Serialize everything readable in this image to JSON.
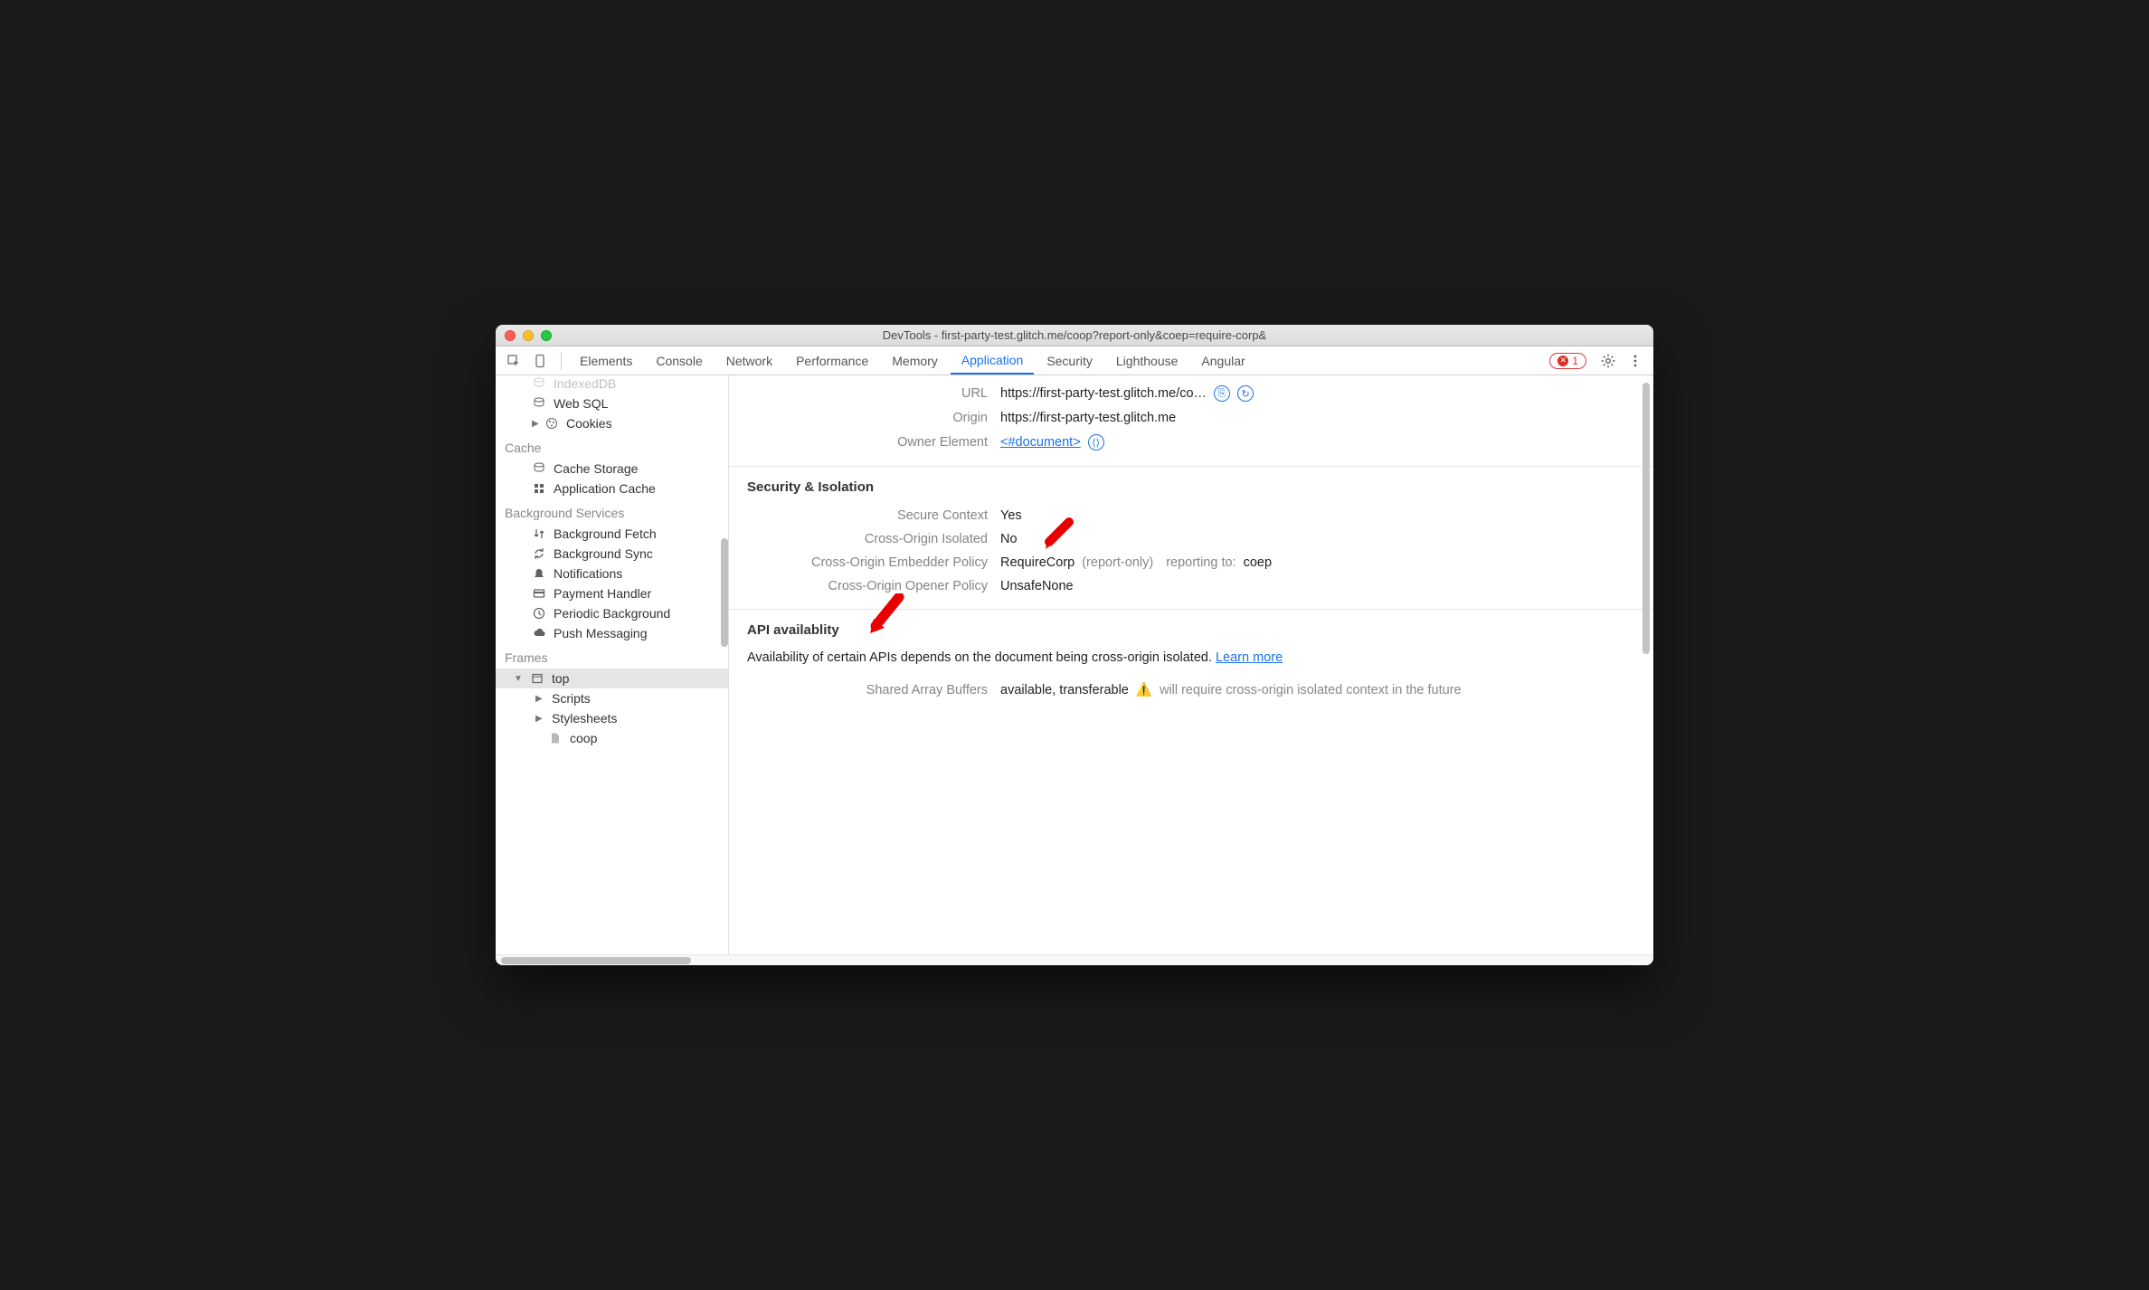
{
  "window": {
    "title": "DevTools - first-party-test.glitch.me/coop?report-only&coep=require-corp&"
  },
  "tabs": {
    "items": [
      "Elements",
      "Console",
      "Network",
      "Performance",
      "Memory",
      "Application",
      "Security",
      "Lighthouse",
      "Angular"
    ],
    "active": "Application"
  },
  "errors": {
    "count": "1"
  },
  "sidebar": {
    "storage": {
      "indexeddb": "IndexedDB",
      "websql": "Web SQL",
      "cookies": "Cookies"
    },
    "cache": {
      "heading": "Cache",
      "cachestorage": "Cache Storage",
      "appcache": "Application Cache"
    },
    "bg": {
      "heading": "Background Services",
      "fetch": "Background Fetch",
      "sync": "Background Sync",
      "notif": "Notifications",
      "pay": "Payment Handler",
      "periodic": "Periodic Background",
      "push": "Push Messaging"
    },
    "frames": {
      "heading": "Frames",
      "top": "top",
      "scripts": "Scripts",
      "stylesheets": "Stylesheets",
      "coop": "coop"
    }
  },
  "main": {
    "url_label": "URL",
    "url_value": "https://first-party-test.glitch.me/co…",
    "origin_label": "Origin",
    "origin_value": "https://first-party-test.glitch.me",
    "owner_label": "Owner Element",
    "owner_value": "<#document>",
    "sec_heading": "Security & Isolation",
    "secure_ctx_label": "Secure Context",
    "secure_ctx_value": "Yes",
    "coi_label": "Cross-Origin Isolated",
    "coi_value": "No",
    "coep_label": "Cross-Origin Embedder Policy",
    "coep_value": "RequireCorp",
    "coep_mode": "(report-only)",
    "coep_reporting_label": "reporting to:",
    "coep_reporting_value": "coep",
    "coop_label": "Cross-Origin Opener Policy",
    "coop_value": "UnsafeNone",
    "api_heading": "API availablity",
    "api_note_prefix": "Availability of certain APIs depends on the document being cross-origin isolated. ",
    "api_learn": "Learn more",
    "sab_label": "Shared Array Buffers",
    "sab_value": "available, transferable",
    "sab_warn": "will require cross-origin isolated context in the future"
  }
}
